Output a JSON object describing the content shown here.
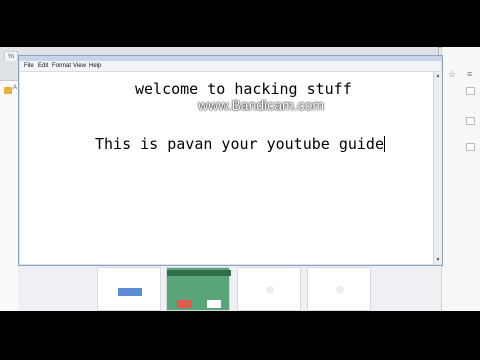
{
  "watermark": "www.Bandicam.com",
  "browser": {
    "tab_label": "Yo",
    "bookmark_label": "A",
    "window_controls": {
      "minimize": "–",
      "maximize": "□",
      "close": "✕"
    },
    "icons": {
      "star": "☆",
      "menu": "≡"
    }
  },
  "notepad": {
    "menu": [
      "File",
      "Edit",
      "Format",
      "View",
      "Help"
    ],
    "text_lines": [
      "welcome to hacking stuff",
      "This is pavan your youtube guide"
    ],
    "scroll_up": "▲",
    "scroll_down": "▼"
  },
  "colors": {
    "notepad_frame": "#d9e3ee",
    "close_button": "#c9473d"
  }
}
